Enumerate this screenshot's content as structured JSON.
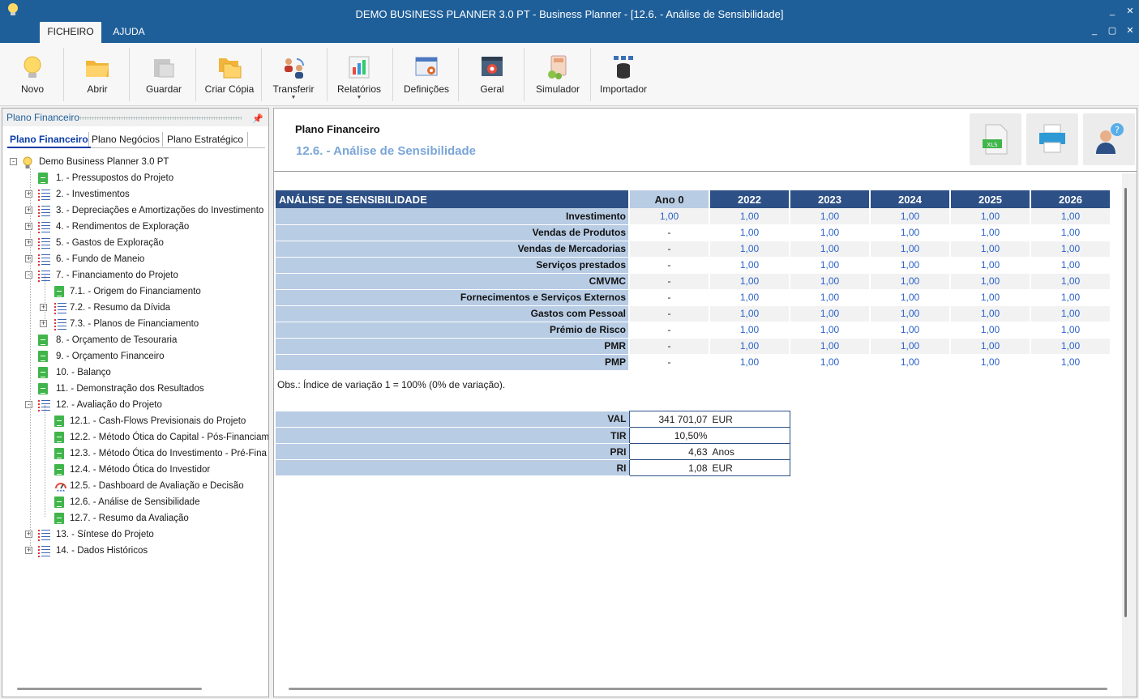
{
  "window": {
    "title": "DEMO BUSINESS PLANNER 3.0 PT - Business Planner - [12.6. - Análise de Sensibilidade]",
    "controls": [
      "_",
      "□",
      "✕",
      "_",
      "▢",
      "✕"
    ]
  },
  "menu_tabs": [
    "FICHEIRO",
    "AJUDA"
  ],
  "ribbon": [
    {
      "label": "Novo",
      "icon": "lightbulb-icon"
    },
    {
      "label": "Abrir",
      "icon": "folder-open-icon"
    },
    {
      "label": "Guardar",
      "icon": "save-icon"
    },
    {
      "label": "Criar Cópia",
      "icon": "copy-folder-icon"
    },
    {
      "label": "Transferir",
      "icon": "transfer-users-icon",
      "dropdown": true
    },
    {
      "label": "Relatórios",
      "icon": "reports-chart-icon",
      "dropdown": true
    },
    {
      "label": "Definições",
      "icon": "settings-window-icon"
    },
    {
      "label": "Geral",
      "icon": "general-gear-icon"
    },
    {
      "label": "Simulador",
      "icon": "calculator-icon"
    },
    {
      "label": "Importador",
      "icon": "database-import-icon"
    }
  ],
  "left_panel": {
    "title": "Plano Financeiro",
    "pin": "📌",
    "tabs": [
      "Plano Financeiro",
      "Plano Negócios",
      "Plano Estratégico"
    ],
    "tree": [
      {
        "label": "Demo Business Planner 3.0 PT",
        "level": 0,
        "icon": "root",
        "expander": "-"
      },
      {
        "label": "1. - Pressupostos do Projeto",
        "level": 1,
        "icon": "doc"
      },
      {
        "label": "2. - Investimentos",
        "level": 1,
        "icon": "list",
        "expander": "+"
      },
      {
        "label": "3. - Depreciações e Amortizações do Investimento",
        "level": 1,
        "icon": "list",
        "expander": "+"
      },
      {
        "label": "4. - Rendimentos de Exploração",
        "level": 1,
        "icon": "list",
        "expander": "+"
      },
      {
        "label": "5. - Gastos de Exploração",
        "level": 1,
        "icon": "list",
        "expander": "+"
      },
      {
        "label": "6. - Fundo de Maneio",
        "level": 1,
        "icon": "list",
        "expander": "+"
      },
      {
        "label": "7. - Financiamento do Projeto",
        "level": 1,
        "icon": "list",
        "expander": "-"
      },
      {
        "label": "7.1. - Origem do Financiamento",
        "level": 2,
        "icon": "doc"
      },
      {
        "label": "7.2. - Resumo da Dívida",
        "level": 2,
        "icon": "list",
        "expander": "+"
      },
      {
        "label": "7.3. - Planos de Financiamento",
        "level": 2,
        "icon": "list",
        "expander": "+"
      },
      {
        "label": "8. - Orçamento de Tesouraria",
        "level": 1,
        "icon": "doc"
      },
      {
        "label": "9. - Orçamento Financeiro",
        "level": 1,
        "icon": "doc"
      },
      {
        "label": "10. - Balanço",
        "level": 1,
        "icon": "doc"
      },
      {
        "label": "11. - Demonstração dos Resultados",
        "level": 1,
        "icon": "doc"
      },
      {
        "label": "12. - Avaliação do Projeto",
        "level": 1,
        "icon": "list",
        "expander": "-"
      },
      {
        "label": "12.1. - Cash-Flows Previsionais do Projeto",
        "level": 2,
        "icon": "doc"
      },
      {
        "label": "12.2. - Método Ótica do Capital - Pós-Financiam",
        "level": 2,
        "icon": "doc"
      },
      {
        "label": "12.3. - Método Ótica do Investimento - Pré-Fina",
        "level": 2,
        "icon": "doc"
      },
      {
        "label": "12.4. - Método Ótica do Investidor",
        "level": 2,
        "icon": "doc"
      },
      {
        "label": "12.5. - Dashboard de Avaliação e Decisão",
        "level": 2,
        "icon": "gauge"
      },
      {
        "label": "12.6. - Análise de Sensibilidade",
        "level": 2,
        "icon": "doc"
      },
      {
        "label": "12.7. - Resumo da Avaliação",
        "level": 2,
        "icon": "doc"
      },
      {
        "label": "13. - Síntese do Projeto",
        "level": 1,
        "icon": "list",
        "expander": "+"
      },
      {
        "label": "14. - Dados Históricos",
        "level": 1,
        "icon": "list",
        "expander": "+"
      }
    ]
  },
  "main": {
    "header_title": "Plano Financeiro",
    "header_subtitle": "12.6. - Análise de Sensibilidade",
    "header_buttons": [
      {
        "icon": "xls-export-icon",
        "badge": "XLS"
      },
      {
        "icon": "printer-icon"
      },
      {
        "icon": "help-user-icon",
        "badge": "?"
      }
    ],
    "table": {
      "header": [
        "ANÁLISE DE SENSIBILIDADE",
        "Ano 0",
        "2022",
        "2023",
        "2024",
        "2025",
        "2026"
      ],
      "rows": [
        {
          "label": "Investimento",
          "values": [
            "1,00",
            "1,00",
            "1,00",
            "1,00",
            "1,00",
            "1,00"
          ]
        },
        {
          "label": "Vendas de Produtos",
          "values": [
            "-",
            "1,00",
            "1,00",
            "1,00",
            "1,00",
            "1,00"
          ]
        },
        {
          "label": "Vendas de Mercadorias",
          "values": [
            "-",
            "1,00",
            "1,00",
            "1,00",
            "1,00",
            "1,00"
          ]
        },
        {
          "label": "Serviços prestados",
          "values": [
            "-",
            "1,00",
            "1,00",
            "1,00",
            "1,00",
            "1,00"
          ]
        },
        {
          "label": "CMVMC",
          "values": [
            "-",
            "1,00",
            "1,00",
            "1,00",
            "1,00",
            "1,00"
          ]
        },
        {
          "label": "Fornecimentos e Serviços Externos",
          "values": [
            "-",
            "1,00",
            "1,00",
            "1,00",
            "1,00",
            "1,00"
          ]
        },
        {
          "label": "Gastos com Pessoal",
          "values": [
            "-",
            "1,00",
            "1,00",
            "1,00",
            "1,00",
            "1,00"
          ]
        },
        {
          "label": "Prémio de Risco",
          "values": [
            "-",
            "1,00",
            "1,00",
            "1,00",
            "1,00",
            "1,00"
          ]
        },
        {
          "label": "PMR",
          "values": [
            "-",
            "1,00",
            "1,00",
            "1,00",
            "1,00",
            "1,00"
          ]
        },
        {
          "label": "PMP",
          "values": [
            "-",
            "1,00",
            "1,00",
            "1,00",
            "1,00",
            "1,00"
          ]
        }
      ]
    },
    "note": "Obs.: Índice de variação 1 = 100% (0% de variação).",
    "kpis": [
      {
        "label": "VAL",
        "value": "341 701,07",
        "unit": "EUR"
      },
      {
        "label": "TIR",
        "value": "10,50%",
        "unit": ""
      },
      {
        "label": "PRI",
        "value": "4,63",
        "unit": "Anos"
      },
      {
        "label": "RI",
        "value": "1,08",
        "unit": "EUR"
      }
    ]
  },
  "colors": {
    "titlebar": "#1f5f99",
    "table_header": "#2d5086",
    "label_bg": "#b8cce4",
    "value_text": "#2b62c7",
    "subtitle": "#7aa5d8"
  }
}
